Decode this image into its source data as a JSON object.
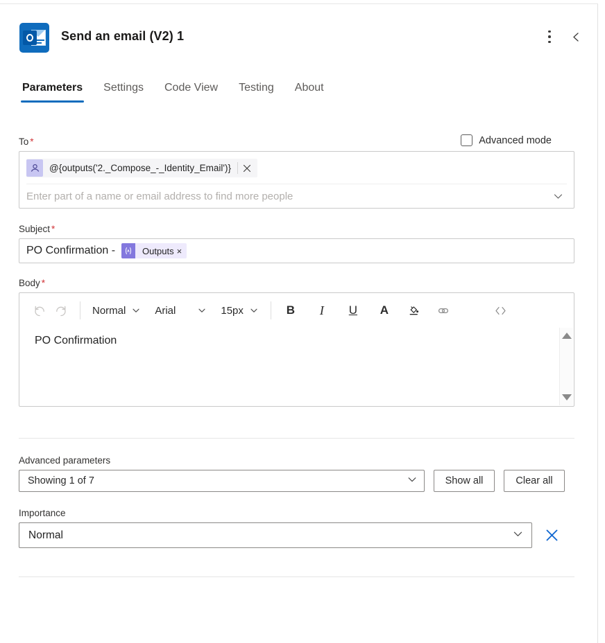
{
  "header": {
    "title": "Send an email (V2) 1",
    "app_icon": "outlook-icon",
    "more_label": "more-options",
    "collapse_label": "collapse-panel"
  },
  "tabs": [
    {
      "label": "Parameters",
      "active": true
    },
    {
      "label": "Settings",
      "active": false
    },
    {
      "label": "Code View",
      "active": false
    },
    {
      "label": "Testing",
      "active": false
    },
    {
      "label": "About",
      "active": false
    }
  ],
  "advanced_mode": {
    "label": "Advanced mode",
    "checked": false
  },
  "to_field": {
    "label": "To",
    "required": "*",
    "token": "@{outputs('2._Compose_-_Identity_Email')}",
    "token_remove": "×",
    "placeholder": "Enter part of a name or email address to find more people"
  },
  "subject_field": {
    "label": "Subject",
    "required": "*",
    "text": "PO Confirmation -",
    "token_label": "Outputs",
    "token_remove": "×"
  },
  "body_field": {
    "label": "Body",
    "required": "*",
    "content": "PO Confirmation",
    "toolbar": {
      "undo": "undo-icon",
      "redo": "redo-icon",
      "style": "Normal",
      "font": "Arial",
      "size": "15px",
      "bold": "B",
      "italic": "I",
      "underline": "U",
      "font_color": "A",
      "highlight": "highlight-icon",
      "link": "link-icon",
      "code": "‹›"
    }
  },
  "advanced_parameters": {
    "label": "Advanced parameters",
    "selected": "Showing 1 of 7",
    "show_all": "Show all",
    "clear_all": "Clear all"
  },
  "importance": {
    "label": "Importance",
    "value": "Normal",
    "clear": "clear-importance"
  },
  "colors": {
    "accent": "#0f6cbd",
    "required": "#d13438",
    "token_purple": "#8378de",
    "token_purple_bg": "#eeeafc",
    "avatar_lavender": "#c8c6f2",
    "clear_blue": "#1268d1"
  }
}
